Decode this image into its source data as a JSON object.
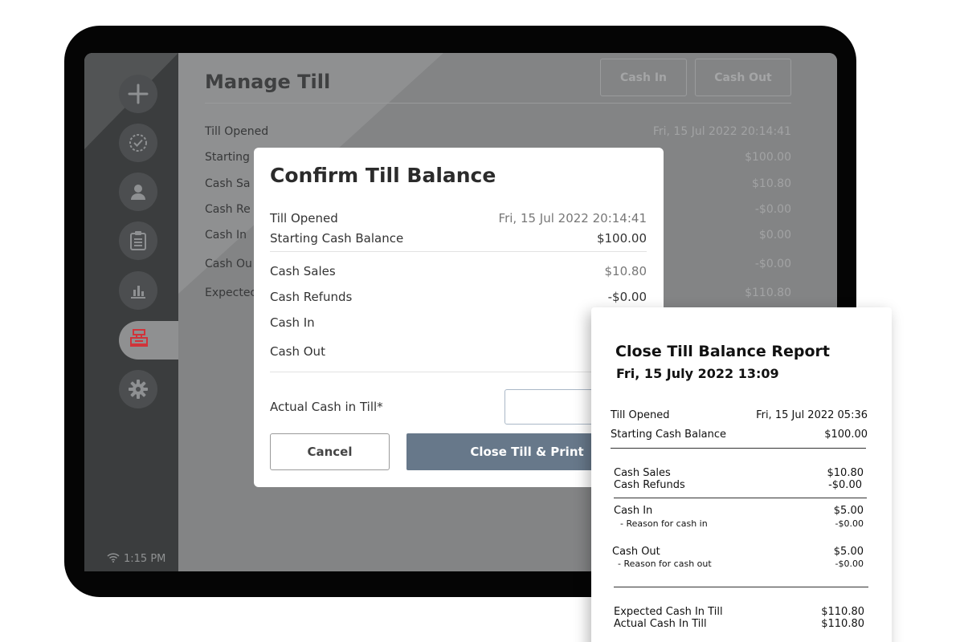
{
  "status_bar": {
    "time": "1:15 PM"
  },
  "sidebar": {
    "items": [
      {
        "icon": "plus-icon"
      },
      {
        "icon": "check-circle-icon"
      },
      {
        "icon": "user-icon"
      },
      {
        "icon": "clipboard-icon"
      },
      {
        "icon": "bar-chart-icon"
      },
      {
        "icon": "cash-register-icon",
        "active": true
      },
      {
        "icon": "gear-icon"
      }
    ],
    "active_color": "#d0343a"
  },
  "manage_till": {
    "title": "Manage Till",
    "cash_in_label": "Cash In",
    "cash_out_label": "Cash Out",
    "rows": [
      {
        "label": "Till Opened",
        "value": "Fri, 15 Jul 2022 20:14:41"
      },
      {
        "label": "Starting",
        "value": "$100.00"
      },
      {
        "label": "Cash Sa",
        "value": "$10.80"
      },
      {
        "label": "Cash Re",
        "value": "-$0.00"
      },
      {
        "label": "Cash In",
        "value": "$0.00"
      },
      {
        "label": "Cash Ou",
        "value": "-$0.00"
      },
      {
        "label": "Expectec",
        "value": "$110.80"
      }
    ]
  },
  "confirm_modal": {
    "title": "Confirm Till Balance",
    "rows": [
      {
        "label": "Till Opened",
        "value": "Fri, 15 Jul 2022 20:14:41"
      },
      {
        "label": "Starting Cash Balance",
        "value": "$100.00"
      },
      {
        "label": "Cash Sales",
        "value": "$10.80"
      },
      {
        "label": "Cash Refunds",
        "value": "-$0.00"
      },
      {
        "label": "Cash In",
        "value": ""
      },
      {
        "label": "Cash Out",
        "value": ""
      }
    ],
    "actual_cash_label": "Actual Cash in Till*",
    "actual_cash_value": "$",
    "cancel_label": "Cancel",
    "close_print_label": "Close Till & Print",
    "button_color": "#67788a"
  },
  "receipt": {
    "title": "Close Till Balance Report",
    "date": "Fri, 15 July 2022 13:09",
    "till_opened_label": "Till Opened",
    "till_opened_value": "Fri, 15 Jul 2022   05:36",
    "starting_label": "Starting Cash Balance",
    "starting_value": "$100.00",
    "cash_sales_label": "Cash Sales",
    "cash_sales_value": "$10.80",
    "cash_refunds_label": "Cash Refunds",
    "cash_refunds_value": "-$0.00",
    "cash_in_label": "Cash In",
    "cash_in_value": "$5.00",
    "cash_in_reason_label": "- Reason for cash in",
    "cash_in_reason_value": "-$0.00",
    "cash_out_label": "Cash Out",
    "cash_out_value": "$5.00",
    "cash_out_reason_label": "- Reason for cash out",
    "cash_out_reason_value": "-$0.00",
    "expected_label": "Expected Cash In Till",
    "expected_value": "$110.80",
    "actual_label": "Actual Cash In Till",
    "actual_value": "$110.80"
  }
}
